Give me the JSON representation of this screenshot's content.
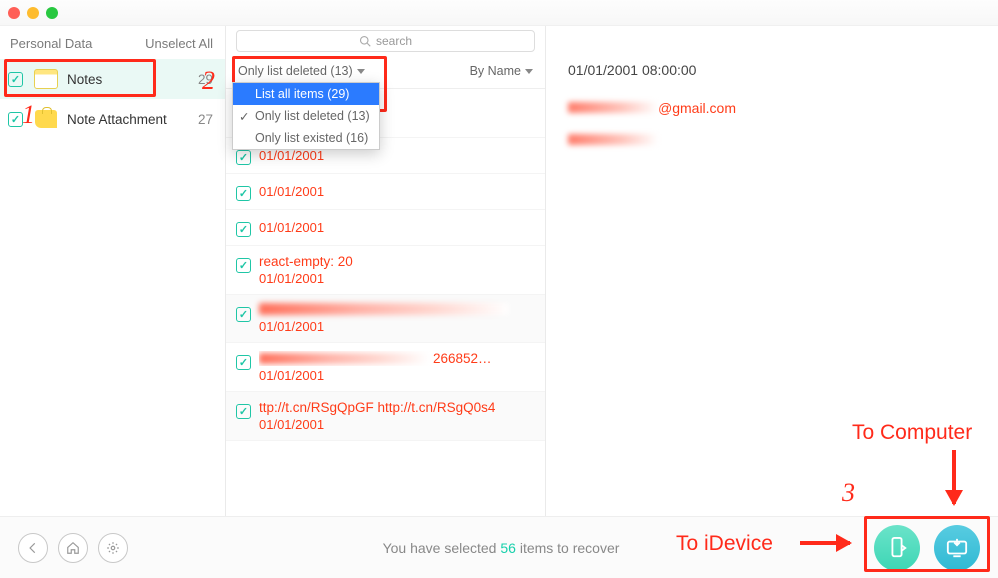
{
  "titlebar": {},
  "sidebar": {
    "header_label": "Personal Data",
    "unselect_label": "Unselect All",
    "items": [
      {
        "label": "Notes",
        "count": "29",
        "icon": "notes-icon",
        "selected": true
      },
      {
        "label": "Note Attachment",
        "count": "27",
        "icon": "attach-icon",
        "selected": false
      }
    ]
  },
  "middle": {
    "search_placeholder": "search",
    "filter_label": "Only list deleted (13)",
    "sort_label": "By Name",
    "dropdown": [
      {
        "label": "List all items (29)",
        "selected": true,
        "checked": false
      },
      {
        "label": "Only list deleted (13)",
        "selected": false,
        "checked": true
      },
      {
        "label": "Only list existed (16)",
        "selected": false,
        "checked": false
      }
    ],
    "notes": [
      {
        "title": "react-empty: 20",
        "date": "01/01/2001"
      },
      {
        "title": "",
        "date": "01/01/2001"
      },
      {
        "title": "",
        "date": "01/01/2001"
      },
      {
        "title": "",
        "date": "01/01/2001"
      },
      {
        "title": "react-empty: 20",
        "date": "01/01/2001"
      },
      {
        "title": "__blur__",
        "date": "01/01/2001",
        "alt": true
      },
      {
        "title": "__blur__",
        "title_suffix": "266852…",
        "date": "01/01/2001"
      },
      {
        "title": "ttp://t.cn/RSgQpGF http://t.cn/RSgQ0s4",
        "date": "01/01/2001",
        "alt": true
      }
    ]
  },
  "detail": {
    "date": "01/01/2001 08:00:00",
    "email_suffix": "@gmail.com"
  },
  "footer": {
    "status_prefix": "You have selected ",
    "status_count": "56",
    "status_suffix": " items to recover"
  },
  "annotations": {
    "num1": "1",
    "num2": "2",
    "num3": "3",
    "to_idevice": "To iDevice",
    "to_computer": "To Computer"
  }
}
